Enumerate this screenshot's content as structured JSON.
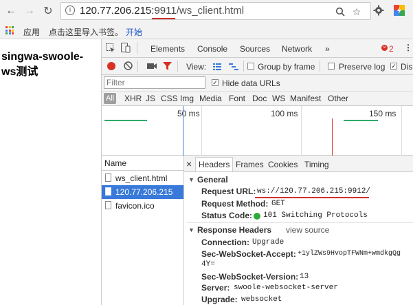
{
  "browser": {
    "url_host": "120.77.206.215:",
    "url_port": "9911",
    "url_path": "/ws_client.html",
    "colors": {
      "annotation": "#d32f2f",
      "accent": "#3879d9"
    }
  },
  "bookmarks": {
    "apps_label": "应用",
    "import_prompt": "点击这里导入书签。",
    "start_link": "开始"
  },
  "page": {
    "title": "singwa-swoole-ws测试"
  },
  "devtools": {
    "tabs": [
      "Elements",
      "Console",
      "Sources",
      "Network"
    ],
    "more_tabs": "»",
    "error_count": "2",
    "toolbar": {
      "view_label": "View:",
      "group_by_frame": "Group by frame",
      "preserve_log": "Preserve log",
      "disable_cache": "Dis"
    },
    "filter": {
      "placeholder": "Filter",
      "hide_data_urls": "Hide data URLs"
    },
    "types": [
      "All",
      "XHR",
      "JS",
      "CSS",
      "Img",
      "Media",
      "Font",
      "Doc",
      "WS",
      "Manifest",
      "Other"
    ],
    "timeline": {
      "labels": [
        "50 ms",
        "100 ms",
        "150 ms"
      ]
    },
    "requests": {
      "header": "Name",
      "items": [
        "ws_client.html",
        "120.77.206.215",
        "favicon.ico"
      ],
      "selected_index": 1
    },
    "detail": {
      "close": "×",
      "tabs": [
        "Headers",
        "Frames",
        "Cookies",
        "Timing"
      ],
      "general": {
        "title": "General",
        "request_url_key": "Request URL:",
        "request_url_val": "ws://120.77.206.215:9912/",
        "request_method_key": "Request Method:",
        "request_method_val": "GET",
        "status_code_key": "Status Code:",
        "status_code_val": "101 Switching Protocols"
      },
      "response_headers": {
        "title": "Response Headers",
        "view_source": "view source",
        "connection_key": "Connection:",
        "connection_val": "Upgrade",
        "accept_key": "Sec-WebSocket-Accept:",
        "accept_val_1": "+1ylZWs9HvopTFWNm+wmdkgQg",
        "accept_val_2": "4Y=",
        "version_key": "Sec-WebSocket-Version:",
        "version_val": "13",
        "server_key": "Server:",
        "server_val": "swoole-websocket-server",
        "upgrade_key": "Upgrade:",
        "upgrade_val": "websocket"
      }
    }
  }
}
